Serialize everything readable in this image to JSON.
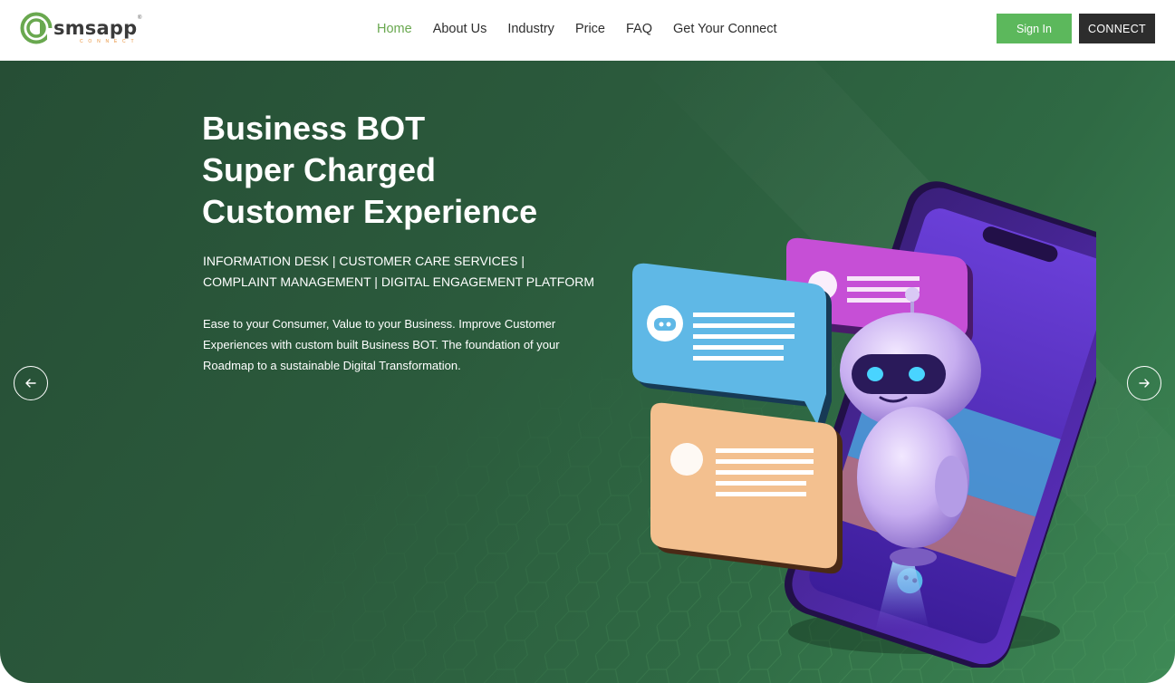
{
  "brand": {
    "name": "smsapp",
    "sub": "CONNECT",
    "reg": "®",
    "colors": {
      "green": "#69a84f",
      "orange": "#e8923b",
      "dark": "#3a3a3a"
    }
  },
  "nav": {
    "items": [
      {
        "label": "Home",
        "active": true
      },
      {
        "label": "About Us",
        "active": false
      },
      {
        "label": "Industry",
        "active": false
      },
      {
        "label": "Price",
        "active": false
      },
      {
        "label": "FAQ",
        "active": false
      },
      {
        "label": "Get Your Connect",
        "active": false
      }
    ]
  },
  "header": {
    "signin_label": "Sign In",
    "connect_label": "CONNECT"
  },
  "hero": {
    "title_lines": [
      "Business BOT",
      "Super Charged",
      "Customer Experience"
    ],
    "services_lines": [
      "INFORMATION DESK | CUSTOMER CARE SERVICES |",
      "COMPLAINT MANAGEMENT | DIGITAL ENGAGEMENT PLATFORM"
    ],
    "description_lines": [
      "Ease to your Consumer, Value to your Business. Improve Customer",
      "Experiences with custom built Business BOT. The foundation of your",
      "Roadmap to a sustainable Digital Transformation."
    ],
    "prev_icon": "arrow-left-icon",
    "next_icon": "arrow-right-icon",
    "illustration": "robot-phone-chat-illustration"
  }
}
